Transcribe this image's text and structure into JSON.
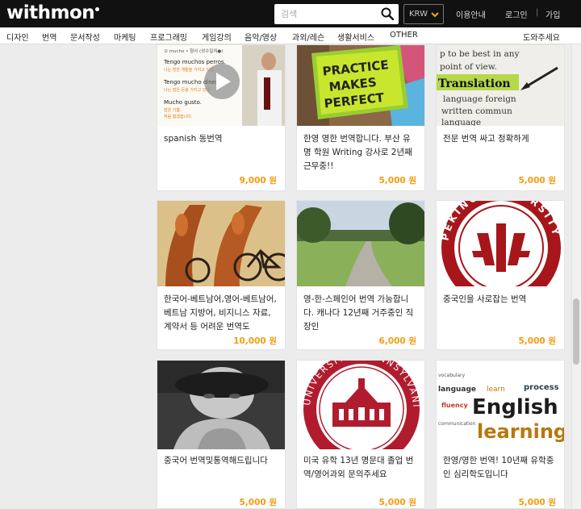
{
  "header": {
    "logo": "withmon",
    "search_placeholder": "검색",
    "currency": "KRW",
    "links": [
      "이용안내",
      "로그인",
      "가입"
    ]
  },
  "categories": [
    "디자인",
    "번역",
    "문서작성",
    "마케팅",
    "프로그래밍",
    "게임강의",
    "음악/영상",
    "과외/레슨",
    "생활서비스",
    "OTHER",
    "도와주세요"
  ],
  "cards": [
    {
      "title": "spanish 동번역",
      "price": "9,000 원",
      "image": "spanish-lesson-video",
      "video_text": [
        "Tengo muchos perros.",
        "나는 많은 개들을 가지고 있다.",
        "Tengo mucho dinero.",
        "나는 많은 돈을 가지고 있다.",
        "Mucho gusto.",
        "많은 기쁨.",
        "처음 뵙겠습니다."
      ],
      "video_header": "② mucho • 형사 (성수일치●)"
    },
    {
      "title": "한영 영한 번역합니다. 부산 유명 학원 Writing 강사로 2년째 근무중!!",
      "price": "5,000 원",
      "image": "practice-makes-perfect-notes",
      "note_text": [
        "PRACTICE",
        "MAKES",
        "PERFECT"
      ]
    },
    {
      "title": "전문 번역 싸고 정확하게",
      "price": "5,000 원",
      "image": "translation-dictionary",
      "dict_text": [
        "p to be best in any",
        "point of view.",
        "Translation",
        "language foreign",
        "written commun",
        "language"
      ]
    },
    {
      "title": "한국어-베트남어,영어-베트남어, 베트남 지방어, 비지니스 자료,계약서 등 어려운 번역도",
      "price": "10,000 원",
      "image": "bicycle-mural"
    },
    {
      "title": "영-한-스페인어 번역 가능합니다. 캐나다 12년째 거주중인 직장인",
      "price": "6,000 원",
      "image": "park-path"
    },
    {
      "title": "중국인을 사로잡는 번역",
      "price": "5,000 원",
      "image": "peking-university-seal",
      "seal_text": "PEKING UNIVERSITY"
    },
    {
      "title": "중국어 번역및통역해드립니다",
      "price": "5,000 원",
      "image": "portrait-photo"
    },
    {
      "title": "미국 유학 13년 명문대 졸업 번역/영어과외 문의주세요",
      "price": "5,000 원",
      "image": "university-seal",
      "seal_text": "UNIVERSITAS PENNSYLVANIENSIS"
    },
    {
      "title": "한영/영한 번역! 10년째 유학중인 심리학도입니다",
      "price": "5,000 원",
      "image": "english-learning-wordcloud",
      "cloud_text": [
        "English",
        "learning",
        "language",
        "fluency",
        "learn",
        "process",
        "communication",
        "vocabulary"
      ]
    }
  ],
  "colors": {
    "topbar": "#111111",
    "price": "#f39c12",
    "accent": "#f5a623"
  }
}
